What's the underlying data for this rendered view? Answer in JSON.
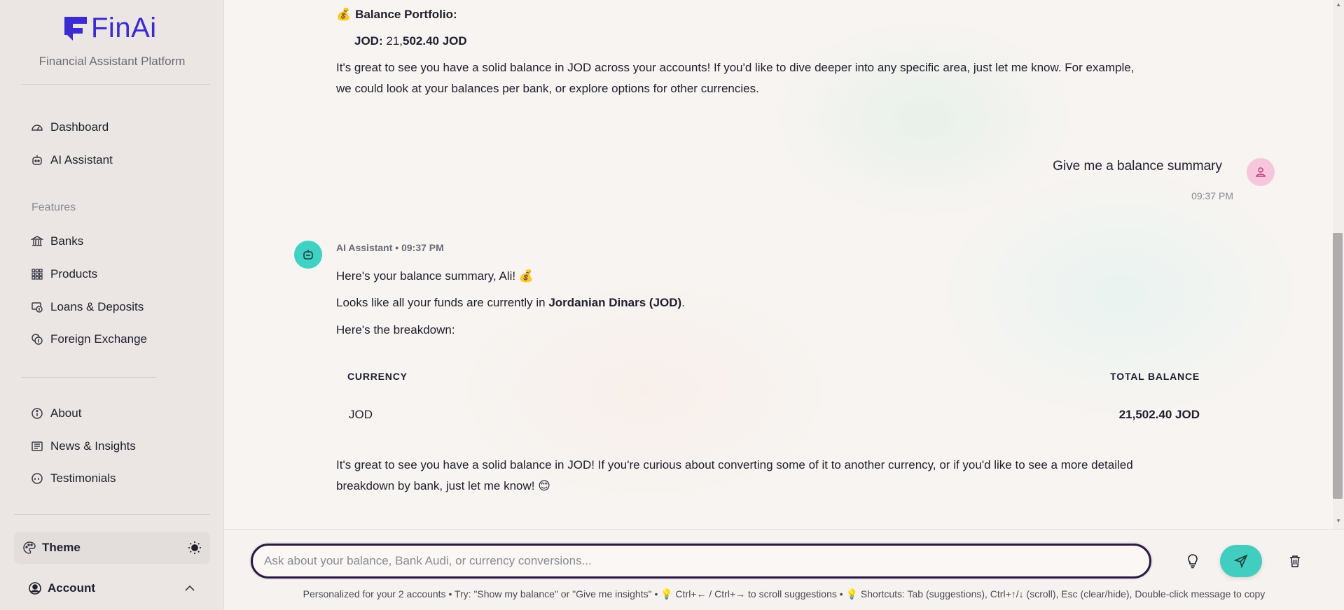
{
  "app": {
    "brand": "FinAi",
    "tagline": "Financial Assistant Platform",
    "accent": "#3b2bd1"
  },
  "sidebar": {
    "primary": [
      {
        "label": "Dashboard",
        "icon": "gauge-icon"
      },
      {
        "label": "AI Assistant",
        "icon": "robot-icon"
      }
    ],
    "features_label": "Features",
    "features": [
      {
        "label": "Banks",
        "icon": "bank-icon"
      },
      {
        "label": "Products",
        "icon": "grid-icon"
      },
      {
        "label": "Loans & Deposits",
        "icon": "loan-icon"
      },
      {
        "label": "Foreign Exchange",
        "icon": "exchange-icon"
      }
    ],
    "info": [
      {
        "label": "About",
        "icon": "info-icon"
      },
      {
        "label": "News & Insights",
        "icon": "newspaper-icon"
      },
      {
        "label": "Testimonials",
        "icon": "quote-icon"
      }
    ],
    "theme_label": "Theme",
    "account_label": "Account"
  },
  "chat": {
    "prev_heading_emoji": "💰",
    "prev_heading": "Balance Portfolio:",
    "prev_jod_label": "JOD:",
    "prev_jod_value_plain": " 21,",
    "prev_jod_value_bold": "502.40 JOD",
    "prev_text_1": "It's great to see you have a solid balance in JOD across your accounts! If you'd like to dive deeper into any specific area, just let me know. For example,",
    "prev_text_2": "we could look at your balances per bank, or explore options for other currencies.",
    "user_message": "Give me a balance summary",
    "user_time": "09:37 PM",
    "bot_sender": "AI Assistant",
    "bot_time": "09:37 PM",
    "bot_line_1": "Here's your balance summary, Ali! 💰",
    "bot_line_2_pre": "Looks like all your funds are currently in ",
    "bot_line_2_bold": "Jordanian Dinars (JOD)",
    "bot_line_2_post": ".",
    "bot_line_3": "Here's the breakdown:",
    "table": {
      "headers": [
        "CURRENCY",
        "TOTAL BALANCE"
      ],
      "rows": [
        [
          "JOD",
          "21,502.40 JOD"
        ]
      ]
    },
    "bot_outro_1": "It's great to see you have a solid balance in JOD! If you're curious about converting some of it to another currency, or if you'd like to see a more detailed",
    "bot_outro_2": "breakdown by bank, just let me know! 😊"
  },
  "composer": {
    "placeholder": "Ask about your balance, Bank Audi, or currency conversions...",
    "hint": "Personalized for your 2 accounts • Try: \"Show my balance\" or \"Give me insights\" • 💡 Ctrl+← / Ctrl+→ to scroll suggestions • 💡 Shortcuts: Tab (suggestions), Ctrl+↑/↓ (scroll), Esc (clear/hide), Double-click message to copy"
  }
}
